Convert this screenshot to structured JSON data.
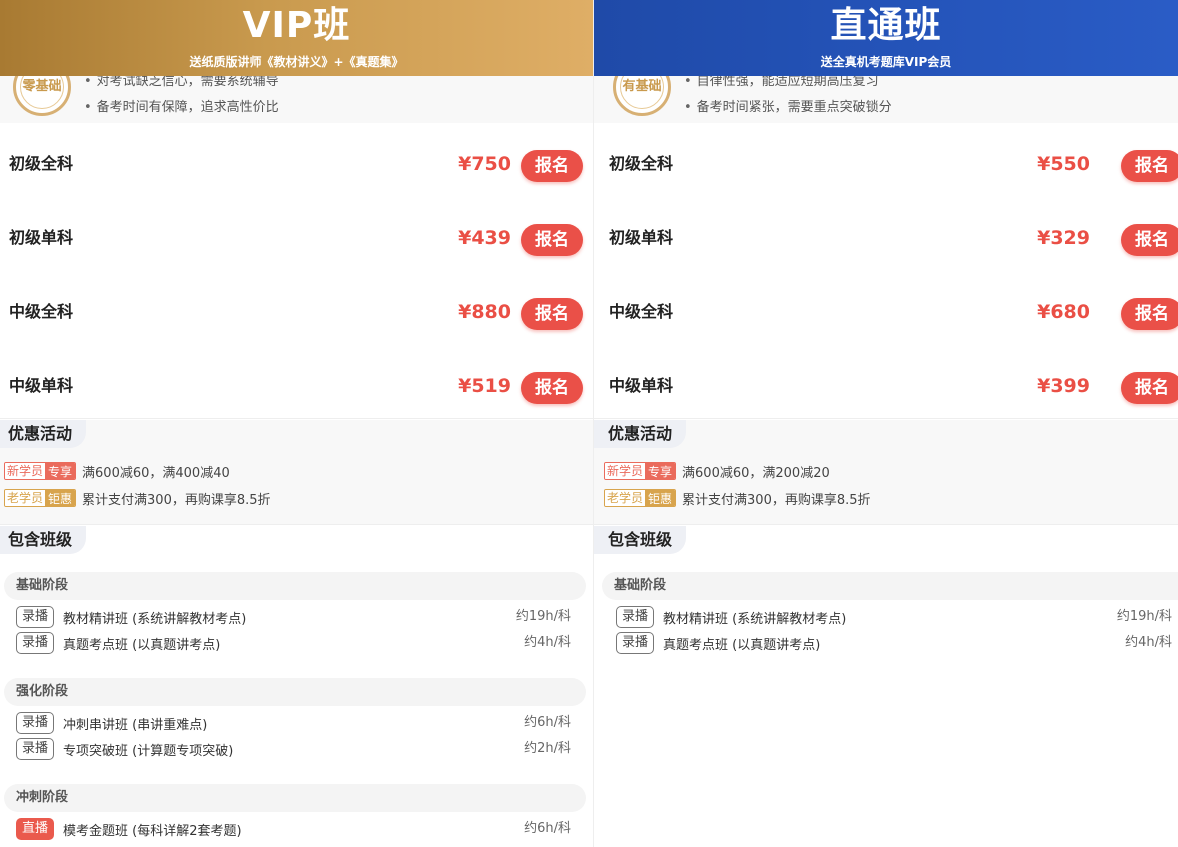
{
  "colors": {
    "accent_red": "#ea5048",
    "vip_gold": "#c99a4e",
    "direct_blue": "#2453b8"
  },
  "plans": [
    {
      "title": "VIP班",
      "subtitle": "送纸质版讲师《教材讲义》+《真题集》",
      "seal_text": "零基础",
      "audience": [
        "对考试缺乏信心，需要系统辅导",
        "备考时间有保障，追求高性价比"
      ],
      "prices": [
        {
          "name": "初级全科",
          "price": "¥750",
          "button": "报名"
        },
        {
          "name": "初级单科",
          "price": "¥439",
          "button": "报名"
        },
        {
          "name": "中级全科",
          "price": "¥880",
          "button": "报名"
        },
        {
          "name": "中级单科",
          "price": "¥519",
          "button": "报名"
        }
      ],
      "promo_title": "优惠活动",
      "promos": [
        {
          "tag_a": "新学员",
          "tag_b": "专享",
          "text": "满600减60，满400减40"
        },
        {
          "tag_a": "老学员",
          "tag_b": "钜惠",
          "text": "累计支付满300，再购课享8.5折"
        }
      ],
      "include_title": "包含班级",
      "stages": [
        {
          "name": "基础阶段",
          "lessons": [
            {
              "badge": "录播",
              "name": "教材精讲班 (系统讲解教材考点)",
              "duration": "约19h/科"
            },
            {
              "badge": "录播",
              "name": "真题考点班 (以真题讲考点)",
              "duration": "约4h/科"
            }
          ]
        },
        {
          "name": "强化阶段",
          "lessons": [
            {
              "badge": "录播",
              "name": "冲刺串讲班 (串讲重难点)",
              "duration": "约6h/科"
            },
            {
              "badge": "录播",
              "name": "专项突破班 (计算题专项突破)",
              "duration": "约2h/科"
            }
          ]
        },
        {
          "name": "冲刺阶段",
          "lessons": [
            {
              "badge": "直播",
              "name": "模考金题班 (每科详解2套考题)",
              "duration": "约6h/科"
            }
          ]
        }
      ]
    },
    {
      "title": "直通班",
      "subtitle": "送全真机考题库VIP会员",
      "seal_text": "有基础",
      "audience": [
        "自律性强，能适应短期高压复习",
        "备考时间紧张，需要重点突破锁分"
      ],
      "prices": [
        {
          "name": "初级全科",
          "price": "¥550",
          "button": "报名"
        },
        {
          "name": "初级单科",
          "price": "¥329",
          "button": "报名"
        },
        {
          "name": "中级全科",
          "price": "¥680",
          "button": "报名"
        },
        {
          "name": "中级单科",
          "price": "¥399",
          "button": "报名"
        }
      ],
      "promo_title": "优惠活动",
      "promos": [
        {
          "tag_a": "新学员",
          "tag_b": "专享",
          "text": "满600减60，满200减20"
        },
        {
          "tag_a": "老学员",
          "tag_b": "钜惠",
          "text": "累计支付满300，再购课享8.5折"
        }
      ],
      "include_title": "包含班级",
      "stages": [
        {
          "name": "基础阶段",
          "lessons": [
            {
              "badge": "录播",
              "name": "教材精讲班 (系统讲解教材考点)",
              "duration": "约19h/科"
            },
            {
              "badge": "录播",
              "name": "真题考点班 (以真题讲考点)",
              "duration": "约4h/科"
            }
          ]
        }
      ]
    }
  ]
}
